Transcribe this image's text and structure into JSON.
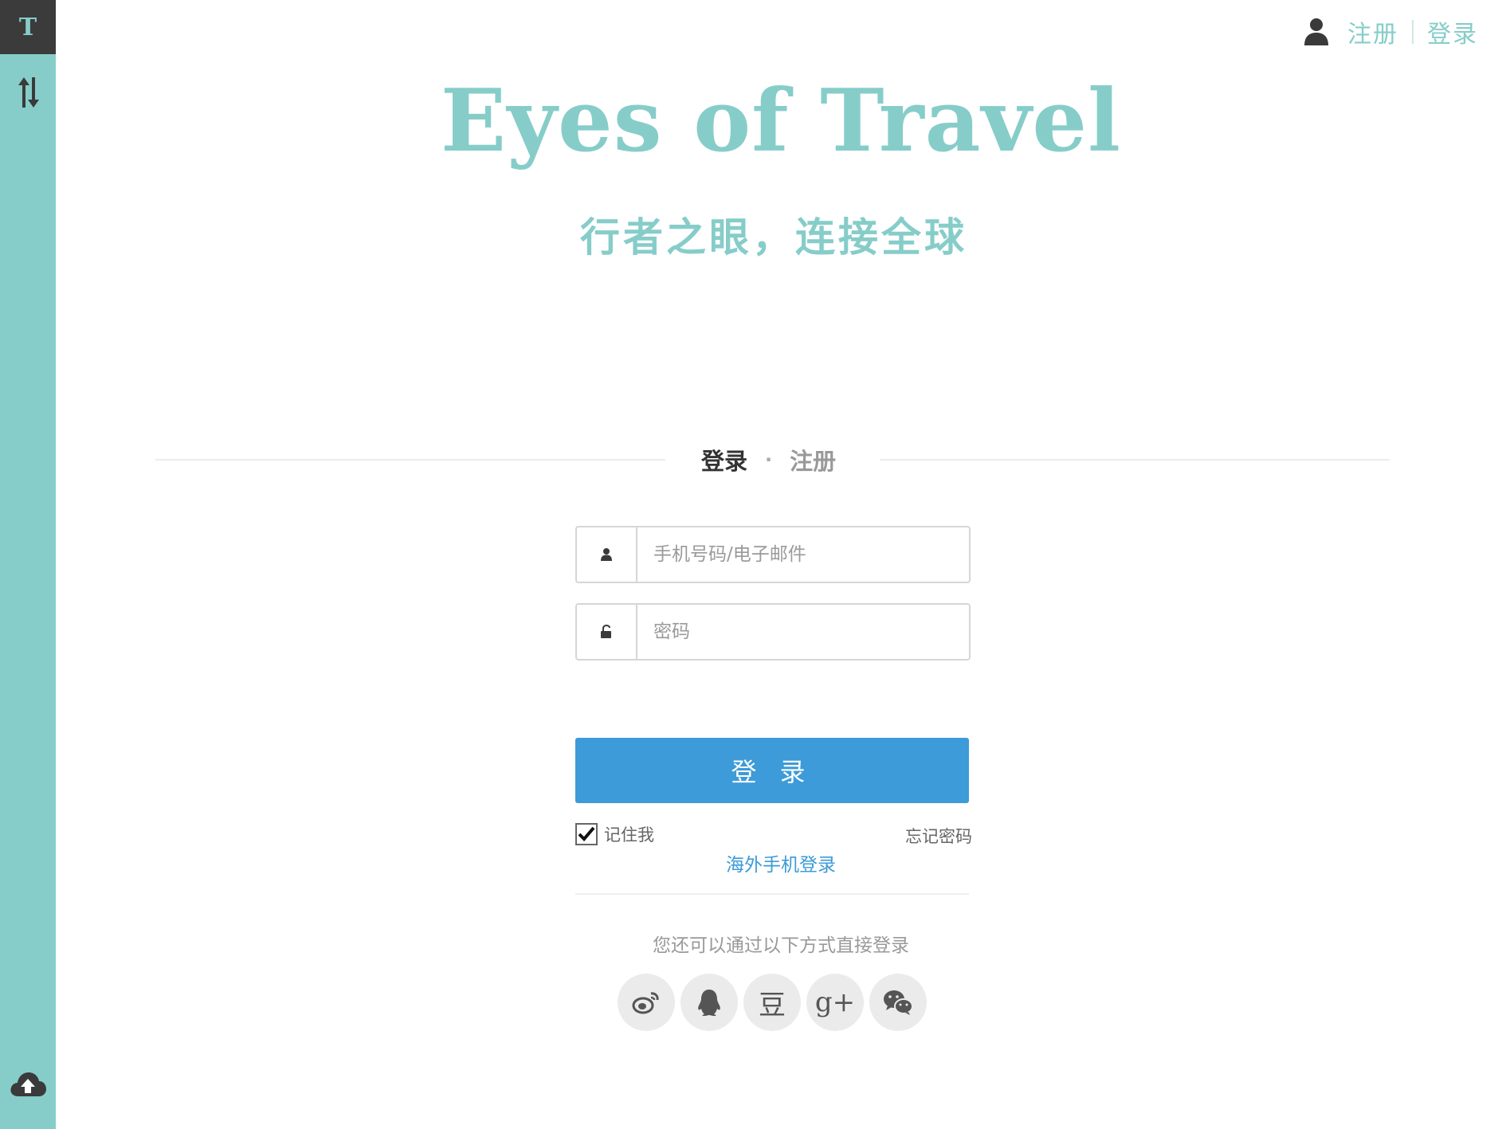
{
  "sidebar": {
    "logo_letter": "T",
    "sort_icon": "sort-arrows-icon",
    "upload_icon": "cloud-upload-icon"
  },
  "header": {
    "register_link": "注册",
    "login_link": "登录",
    "user_icon": "user-icon"
  },
  "hero": {
    "title": "Eyes of Travel",
    "subtitle": "行者之眼，连接全球"
  },
  "tabs": {
    "login": "登录",
    "separator": "·",
    "register": "注册"
  },
  "form": {
    "username_placeholder": "手机号码/电子邮件",
    "password_placeholder": "密码",
    "submit_label": "登 录",
    "remember_label": "记住我",
    "remember_checked": true,
    "forgot_label": "忘记密码",
    "overseas_label": "海外手机登录"
  },
  "social": {
    "prompt": "您还可以通过以下方式直接登录",
    "providers": [
      {
        "name": "weibo",
        "icon": "weibo-icon"
      },
      {
        "name": "qq",
        "icon": "qq-icon"
      },
      {
        "name": "douban",
        "icon": "douban-icon",
        "glyph": "豆"
      },
      {
        "name": "google-plus",
        "icon": "google-plus-icon",
        "glyph": "g+"
      },
      {
        "name": "wechat",
        "icon": "wechat-icon"
      }
    ]
  },
  "colors": {
    "accent": "#86cdc9",
    "sidebar_top": "#3b3b3b",
    "button": "#3c9bd8",
    "link": "#3c9bd8"
  }
}
